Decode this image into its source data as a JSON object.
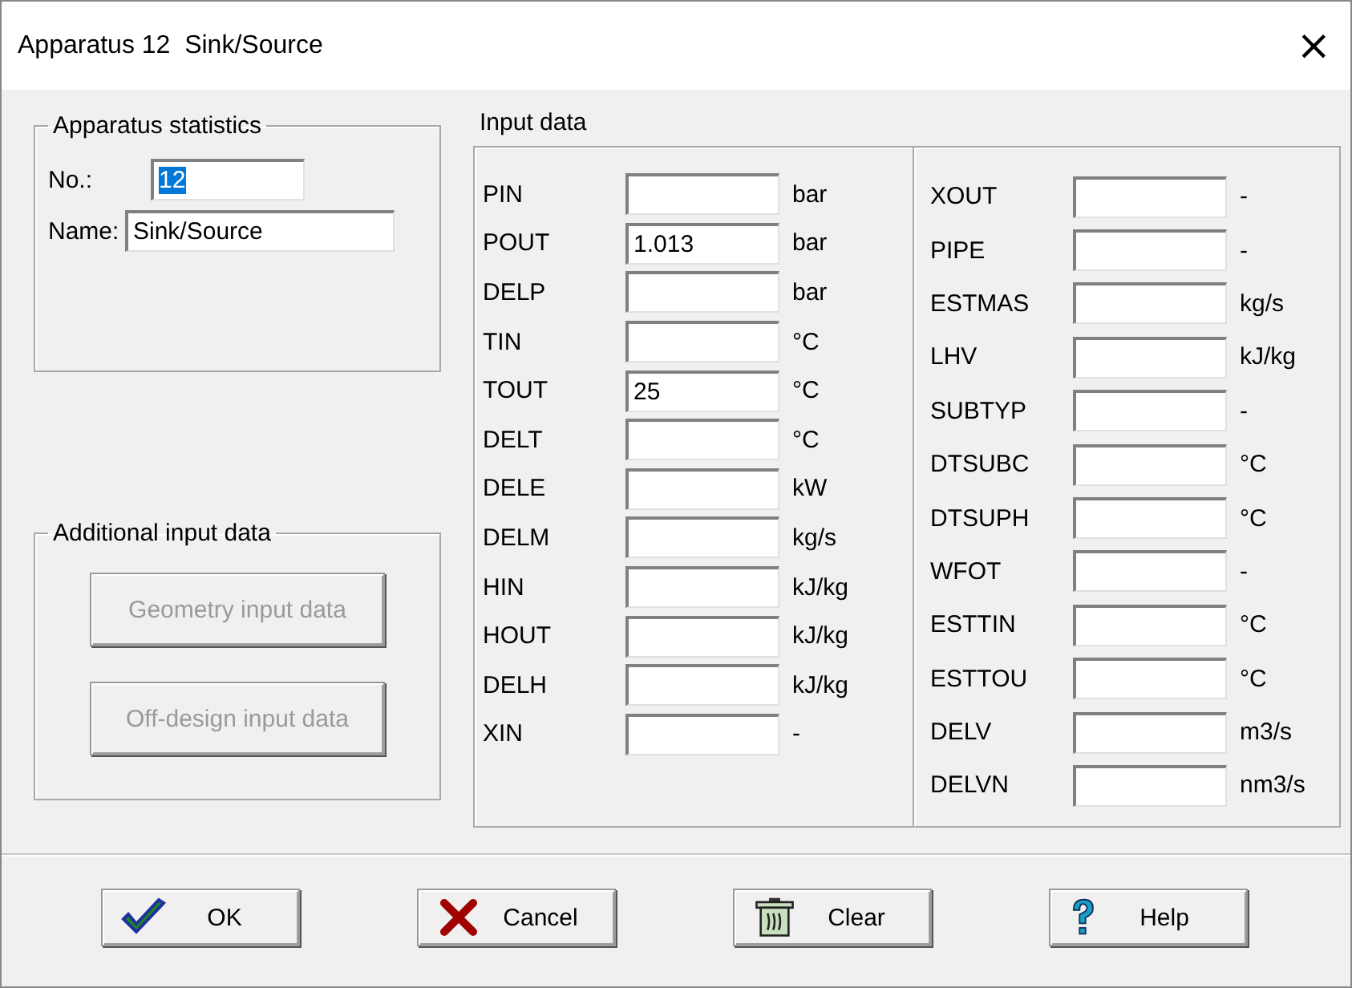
{
  "window": {
    "title": "Apparatus 12  Sink/Source",
    "close": "×"
  },
  "statistics": {
    "title": "Apparatus statistics",
    "fields": [
      {
        "label": "No.:",
        "value": "12",
        "text_selected": true
      },
      {
        "label": "Name:",
        "value": "Sink/Source",
        "text_selected": false
      }
    ]
  },
  "additional": {
    "title": "Additional input data",
    "buttons": [
      {
        "label": "Geometry input data",
        "disabled": true
      },
      {
        "label": "Off-design input data",
        "disabled": true
      }
    ]
  },
  "input_data": {
    "title": "Input data",
    "columns": [
      {
        "rows": [
          {
            "name": "PIN",
            "unit": "bar"
          },
          {
            "name": "POUT",
            "value": "1.013",
            "unit": "bar"
          },
          {
            "name": "DELP",
            "unit": "bar"
          },
          {
            "name": "TIN",
            "unit": "°C"
          },
          {
            "name": "TOUT",
            "value": "25",
            "unit": "°C"
          },
          {
            "name": "DELT",
            "unit": "°C"
          },
          {
            "name": "DELE",
            "unit": "kW"
          },
          {
            "name": "DELM",
            "unit": "kg/s"
          },
          {
            "name": "HIN",
            "unit": "kJ/kg"
          },
          {
            "name": "HOUT",
            "unit": "kJ/kg"
          },
          {
            "name": "DELH",
            "unit": "kJ/kg"
          },
          {
            "name": "XIN",
            "unit": "-"
          }
        ]
      },
      {
        "rows": [
          {
            "name": "XOUT",
            "unit": "-"
          },
          {
            "name": "PIPE",
            "unit": "-"
          },
          {
            "name": "ESTMAS",
            "unit": "kg/s"
          },
          {
            "name": "LHV",
            "unit": "kJ/kg"
          },
          {
            "name": "SUBTYP",
            "unit": "-"
          },
          {
            "name": "DTSUBC",
            "unit": "°C"
          },
          {
            "name": "DTSUPH",
            "unit": "°C"
          },
          {
            "name": "WFOT",
            "unit": "-"
          },
          {
            "name": "ESTTIN",
            "unit": "°C"
          },
          {
            "name": "ESTTOU",
            "unit": "°C"
          },
          {
            "name": "DELV",
            "unit": "m3/s"
          },
          {
            "name": "DELVN",
            "unit": "nm3/s"
          }
        ]
      }
    ]
  },
  "buttons": [
    {
      "label": "OK",
      "kind": "check"
    },
    {
      "label": "Cancel",
      "kind": "cross"
    },
    {
      "label": "Clear",
      "kind": "trash"
    },
    {
      "label": "Help",
      "kind": "question"
    }
  ]
}
